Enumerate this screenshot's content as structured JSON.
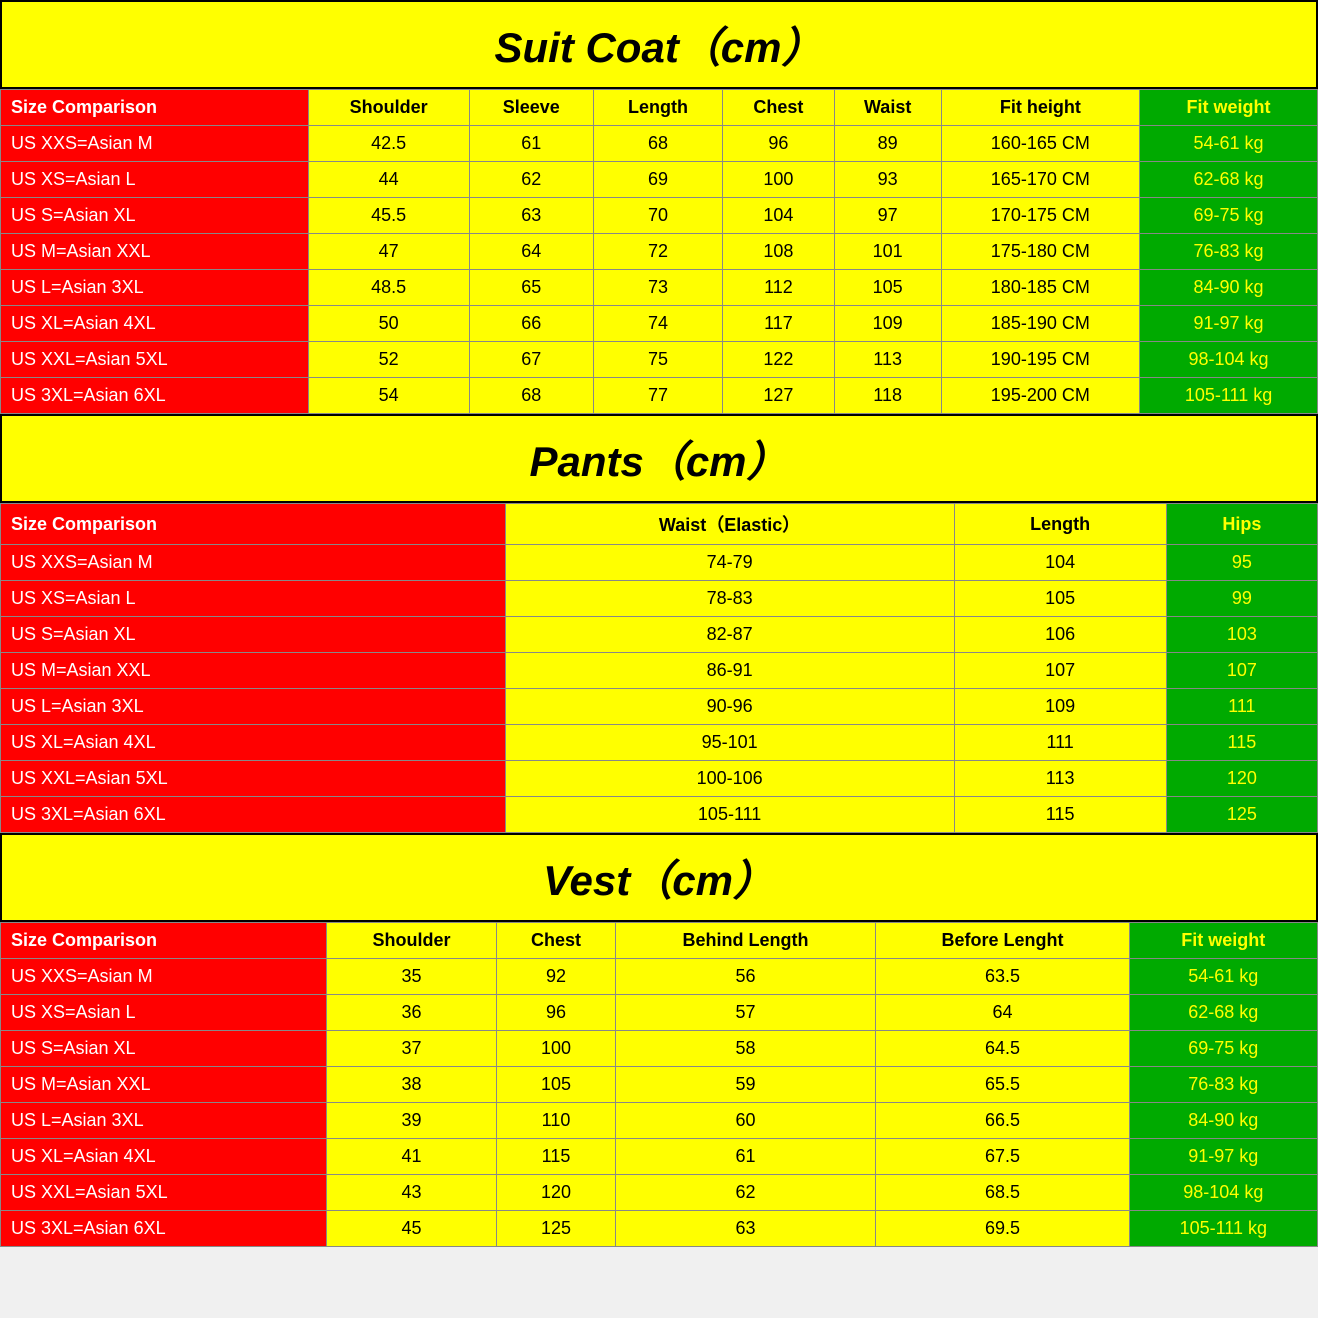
{
  "suit_coat": {
    "title": "Suit Coat（cm）",
    "headers": [
      "Size Comparison",
      "Shoulder",
      "Sleeve",
      "Length",
      "Chest",
      "Waist",
      "Fit height",
      "Fit weight"
    ],
    "rows": [
      [
        "US XXS=Asian M",
        "42.5",
        "61",
        "68",
        "96",
        "89",
        "160-165 CM",
        "54-61 kg"
      ],
      [
        "US XS=Asian L",
        "44",
        "62",
        "69",
        "100",
        "93",
        "165-170 CM",
        "62-68 kg"
      ],
      [
        "US S=Asian XL",
        "45.5",
        "63",
        "70",
        "104",
        "97",
        "170-175 CM",
        "69-75 kg"
      ],
      [
        "US M=Asian XXL",
        "47",
        "64",
        "72",
        "108",
        "101",
        "175-180 CM",
        "76-83 kg"
      ],
      [
        "US L=Asian 3XL",
        "48.5",
        "65",
        "73",
        "112",
        "105",
        "180-185 CM",
        "84-90 kg"
      ],
      [
        "US XL=Asian 4XL",
        "50",
        "66",
        "74",
        "117",
        "109",
        "185-190 CM",
        "91-97 kg"
      ],
      [
        "US XXL=Asian 5XL",
        "52",
        "67",
        "75",
        "122",
        "113",
        "190-195 CM",
        "98-104 kg"
      ],
      [
        "US 3XL=Asian 6XL",
        "54",
        "68",
        "77",
        "127",
        "118",
        "195-200 CM",
        "105-111 kg"
      ]
    ]
  },
  "pants": {
    "title": "Pants（cm）",
    "headers": [
      "Size Comparison",
      "Waist（Elastic）",
      "Length",
      "Hips"
    ],
    "rows": [
      [
        "US XXS=Asian M",
        "74-79",
        "104",
        "95"
      ],
      [
        "US XS=Asian L",
        "78-83",
        "105",
        "99"
      ],
      [
        "US S=Asian XL",
        "82-87",
        "106",
        "103"
      ],
      [
        "US M=Asian XXL",
        "86-91",
        "107",
        "107"
      ],
      [
        "US L=Asian 3XL",
        "90-96",
        "109",
        "111"
      ],
      [
        "US XL=Asian 4XL",
        "95-101",
        "111",
        "115"
      ],
      [
        "US XXL=Asian 5XL",
        "100-106",
        "113",
        "120"
      ],
      [
        "US 3XL=Asian 6XL",
        "105-111",
        "115",
        "125"
      ]
    ]
  },
  "vest": {
    "title": "Vest（cm）",
    "headers": [
      "Size Comparison",
      "Shoulder",
      "Chest",
      "Behind Length",
      "Before Lenght",
      "Fit weight"
    ],
    "rows": [
      [
        "US XXS=Asian M",
        "35",
        "92",
        "56",
        "63.5",
        "54-61 kg"
      ],
      [
        "US XS=Asian L",
        "36",
        "96",
        "57",
        "64",
        "62-68 kg"
      ],
      [
        "US S=Asian XL",
        "37",
        "100",
        "58",
        "64.5",
        "69-75 kg"
      ],
      [
        "US M=Asian XXL",
        "38",
        "105",
        "59",
        "65.5",
        "76-83 kg"
      ],
      [
        "US L=Asian 3XL",
        "39",
        "110",
        "60",
        "66.5",
        "84-90 kg"
      ],
      [
        "US XL=Asian 4XL",
        "41",
        "115",
        "61",
        "67.5",
        "91-97 kg"
      ],
      [
        "US XXL=Asian 5XL",
        "43",
        "120",
        "62",
        "68.5",
        "98-104 kg"
      ],
      [
        "US 3XL=Asian 6XL",
        "45",
        "125",
        "63",
        "69.5",
        "105-111 kg"
      ]
    ]
  }
}
